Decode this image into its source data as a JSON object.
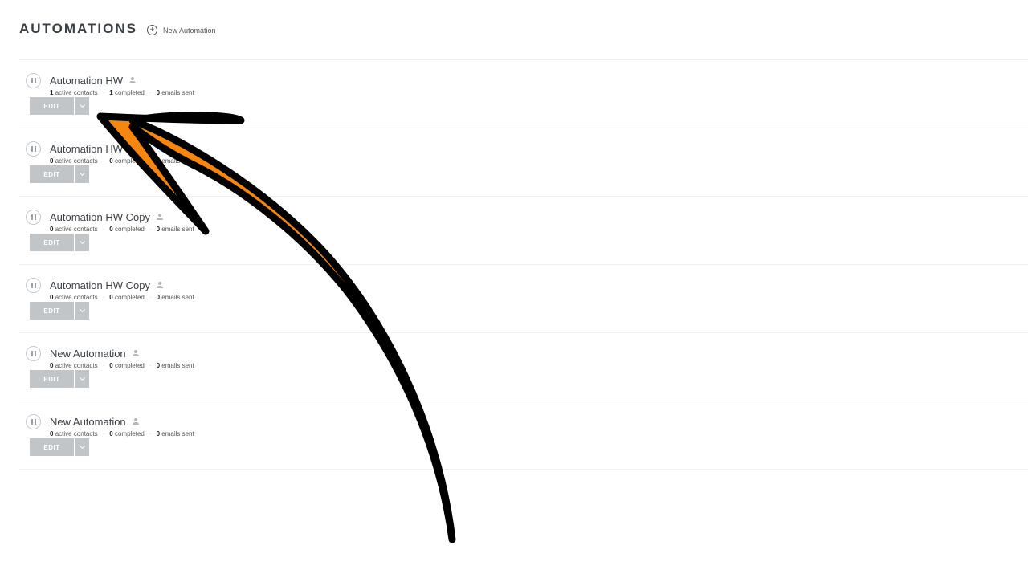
{
  "header": {
    "title": "AUTOMATIONS",
    "new_label": "New Automation"
  },
  "automations": [
    {
      "name": "Automation HW",
      "active": "1",
      "active_label": "active contacts",
      "completed": "1",
      "completed_label": "completed",
      "emails": "0",
      "emails_label": "emails sent",
      "edit_label": "EDIT"
    },
    {
      "name": "Automation HW",
      "active": "0",
      "active_label": "active contacts",
      "completed": "0",
      "completed_label": "completed",
      "emails": "0",
      "emails_label": "emails sent",
      "edit_label": "EDIT"
    },
    {
      "name": "Automation HW Copy",
      "active": "0",
      "active_label": "active contacts",
      "completed": "0",
      "completed_label": "completed",
      "emails": "0",
      "emails_label": "emails sent",
      "edit_label": "EDIT"
    },
    {
      "name": "Automation HW Copy",
      "active": "0",
      "active_label": "active contacts",
      "completed": "0",
      "completed_label": "completed",
      "emails": "0",
      "emails_label": "emails sent",
      "edit_label": "EDIT"
    },
    {
      "name": "New Automation",
      "active": "0",
      "active_label": "active contacts",
      "completed": "0",
      "completed_label": "completed",
      "emails": "0",
      "emails_label": "emails sent",
      "edit_label": "EDIT"
    },
    {
      "name": "New Automation",
      "active": "0",
      "active_label": "active contacts",
      "completed": "0",
      "completed_label": "completed",
      "emails": "0",
      "emails_label": "emails sent",
      "edit_label": "EDIT"
    }
  ],
  "icons": {
    "row_status": "pause-icon",
    "owner": "person-icon",
    "new": "plus-circle-icon",
    "dropdown": "chevron-down-icon"
  },
  "colors": {
    "button_bg": "#c1c5c8",
    "arrow_fill": "#f7860f",
    "arrow_outline": "#000000"
  }
}
